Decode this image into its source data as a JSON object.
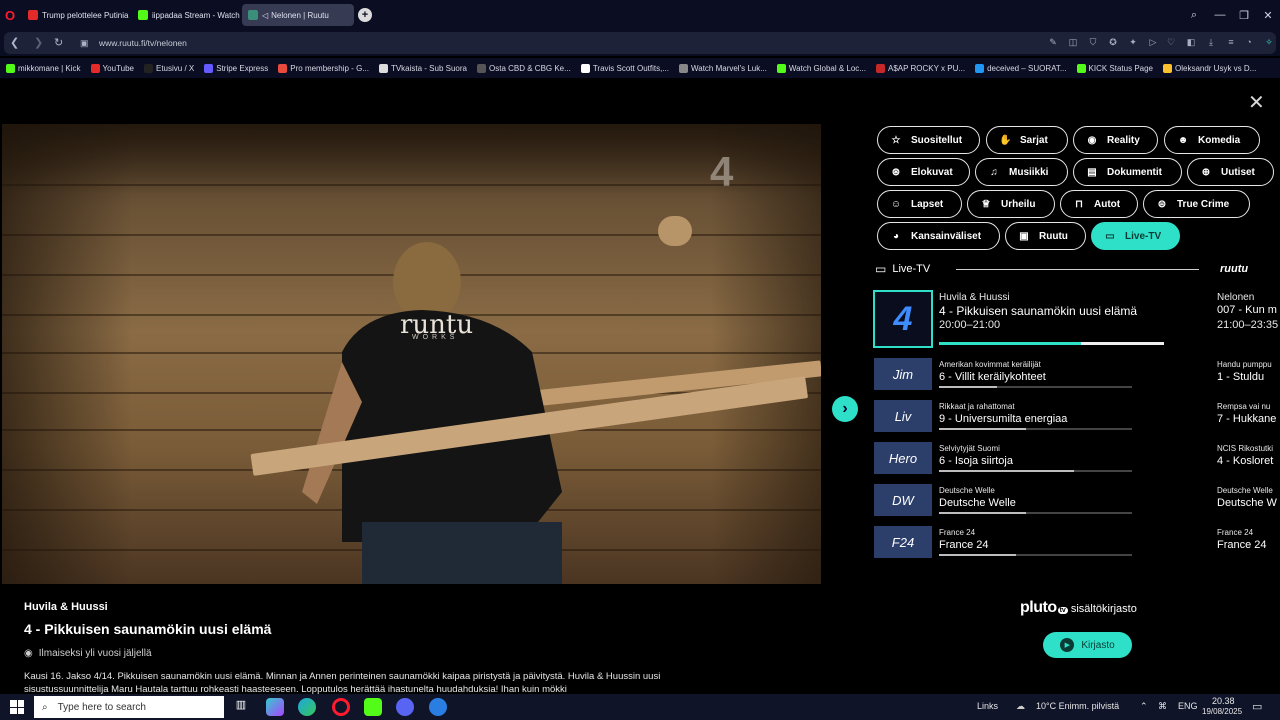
{
  "browser": {
    "tabs": [
      {
        "label": "Trump pelottelee Putinia |",
        "color": "#e52a2a"
      },
      {
        "label": "iippadaa Stream - Watch",
        "color": "#53fc18"
      },
      {
        "label": "Nelonen | Ruutu",
        "color": "#3b8f7a"
      }
    ],
    "new_tab": "+",
    "url": "www.ruutu.fi/tv/nelonen",
    "bookmarks": [
      {
        "label": "mikkomane | Kick",
        "color": "#53fc18"
      },
      {
        "label": "YouTube",
        "color": "#e52a2a"
      },
      {
        "label": "Etusivu / X",
        "color": "#222222"
      },
      {
        "label": "Stripe Express",
        "color": "#635bff"
      },
      {
        "label": "Pro membership - G...",
        "color": "#e84b3c"
      },
      {
        "label": "TVkaista - Sub Suora",
        "color": "#dddddd"
      },
      {
        "label": "Osta CBD & CBG Ke...",
        "color": "#555555"
      },
      {
        "label": "Travis Scott Outfits,...",
        "color": "#ffffff"
      },
      {
        "label": "Watch Marvel's Luk...",
        "color": "#888888"
      },
      {
        "label": "Watch Global & Loc...",
        "color": "#53fc18"
      },
      {
        "label": "A$AP ROCKY x PU...",
        "color": "#c62828"
      },
      {
        "label": "deceived – SUORAT...",
        "color": "#2196f3"
      },
      {
        "label": "KICK Status Page",
        "color": "#53fc18"
      },
      {
        "label": "Oleksandr Usyk vs D...",
        "color": "#fbc02d"
      }
    ]
  },
  "player": {
    "channel_bug": "4",
    "shirt_text": "runtu",
    "shirt_sub": "WORKS"
  },
  "genres": [
    {
      "label": "Suositellut",
      "icon": "☆"
    },
    {
      "label": "Sarjat",
      "icon": "✋"
    },
    {
      "label": "Reality",
      "icon": "◉"
    },
    {
      "label": "Komedia",
      "icon": "☻"
    },
    {
      "label": "Elokuvat",
      "icon": "⊛"
    },
    {
      "label": "Musiikki",
      "icon": "♫"
    },
    {
      "label": "Dokumentit",
      "icon": "▤"
    },
    {
      "label": "Uutiset",
      "icon": "⊕"
    },
    {
      "label": "Lapset",
      "icon": "☺"
    },
    {
      "label": "Urheilu",
      "icon": "♕"
    },
    {
      "label": "Autot",
      "icon": "⊓"
    },
    {
      "label": "True Crime",
      "icon": "⊜"
    },
    {
      "label": "Kansainväliset",
      "icon": "◕"
    },
    {
      "label": "Ruutu",
      "icon": "▣"
    },
    {
      "label": "Live-TV",
      "icon": "▭"
    }
  ],
  "live": {
    "header": "Live-TV",
    "brand": "ruutu",
    "channels": [
      {
        "logo": "4",
        "sub": "Huvila & Huussi",
        "title": "4 - Pikkuisen saunamökin uusi elämä",
        "time": "20:00–21:00",
        "progress": 0.63,
        "next_sub": "Nelonen",
        "next_title": "007 - Kun m",
        "next_time": "21:00–23:35"
      },
      {
        "logo": "Jim",
        "sub": "Amerikan kovimmat keräilijät",
        "title": "6 - Villit keräilykohteet",
        "progress": 0.3,
        "next_sub": "Handu pumppu",
        "next_title": "1 - Stuldu"
      },
      {
        "logo": "Liv",
        "sub": "Rikkaat ja rahattomat",
        "title": "9 - Universumilta energiaa",
        "progress": 0.45,
        "next_sub": "Rempsa vai nu",
        "next_title": "7 - Hukkane"
      },
      {
        "logo": "Hero",
        "sub": "Selviytyjät Suomi",
        "title": "6 - Isoja siirtoja",
        "progress": 0.7,
        "next_sub": "NCIS Rikostutki",
        "next_title": "4 - Kosloret"
      },
      {
        "logo": "DW",
        "sub": "Deutsche Welle",
        "title": "Deutsche Welle",
        "progress": 0.45,
        "next_sub": "Deutsche Welle",
        "next_title": "Deutsche W"
      },
      {
        "logo": "F24",
        "sub": "France 24",
        "title": "France 24",
        "progress": 0.4,
        "next_sub": "France 24",
        "next_title": "France 24"
      }
    ]
  },
  "info": {
    "show": "Huvila & Huussi",
    "episode": "4 - Pikkuisen saunamökin uusi elämä",
    "availability": "Ilmaiseksi yli vuosi jäljellä",
    "description": "Kausi 16. Jakso 4/14. Pikkuisen saunamökin uusi elämä. Minnan ja Annen perinteinen saunamökki kaipaa piristystä ja päivitystä. Huvila & Huussin uusi sisustussuunnittelija Maru Hautala tarttuu rohkeasti haasteeseen. Lopputulos herättää ihastunelta huudahduksia! Ihan kuin mökki"
  },
  "pluto": {
    "brand": "pluto",
    "tv": "tv",
    "label": "sisältökirjasto",
    "button": "Kirjasto"
  },
  "taskbar": {
    "search_placeholder": "Type here to search",
    "links": "Links",
    "weather": "10°C  Enimm. pilvistä",
    "lang": "ENG",
    "time": "20.38",
    "date": "19/08/2025"
  }
}
